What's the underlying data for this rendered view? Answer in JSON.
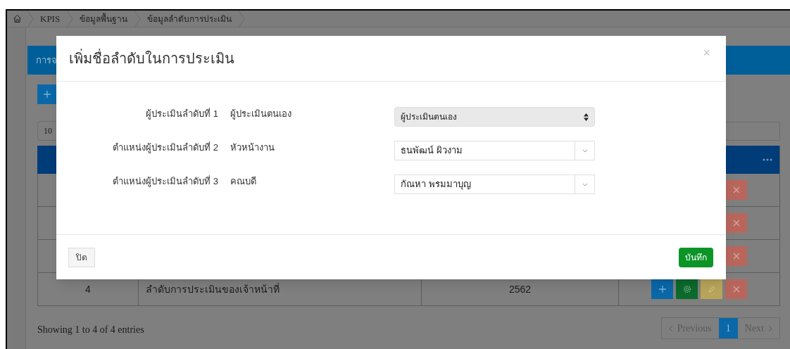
{
  "breadcrumb": [
    "KPIS",
    "ข้อมูลพื้นฐาน",
    "ข้อมูลลำดับการประเมิน"
  ],
  "panel": {
    "title": "การจ"
  },
  "page_length": "10",
  "table": {
    "rows": [
      {
        "cells": [],
        "actions": [
          {
            "kind": "delete"
          }
        ]
      },
      {
        "cells": [],
        "actions": [
          {
            "kind": "delete"
          }
        ]
      },
      {
        "cells": [],
        "actions": [
          {
            "kind": "delete"
          }
        ]
      },
      {
        "cells": [
          "4",
          "ลำดับการประเมินของเจ้าหน้าที่",
          "2562"
        ],
        "actions": [
          {
            "kind": "add"
          },
          {
            "kind": "settings"
          },
          {
            "kind": "edit"
          },
          {
            "kind": "delete"
          }
        ]
      }
    ]
  },
  "info": "Showing 1 to 4 of 4 entries",
  "pagination": [
    {
      "label": "Previous",
      "kind": "prev",
      "selected": false
    },
    {
      "label": "1",
      "kind": "page",
      "selected": true
    },
    {
      "label": "Next",
      "kind": "next",
      "selected": false
    }
  ],
  "modal": {
    "title": "เพิ่มชื่อลำดับในการประเมิน",
    "close": "×",
    "fields": [
      {
        "label": "ผู้ประเมินลำดับที่ 1",
        "role": "ผู้ประเมินตนเอง",
        "value": "ผู้ประเมินตนเอง",
        "kind": "native"
      },
      {
        "label": "ตำแหน่งผู้ประเมินลำดับที่ 2",
        "role": "หัวหน้างาน",
        "value": "ธนพัฒน์ ผิวงาม",
        "kind": "combo"
      },
      {
        "label": "ตำแหน่งผู้ประเมินลำดับที่ 3",
        "role": "คณบดี",
        "value": "กัณหา พรมมาบุญ",
        "kind": "combo"
      }
    ],
    "buttons": [
      {
        "label": "ปิด",
        "kind": "default"
      },
      {
        "label": "บันทึก",
        "kind": "primary"
      }
    ]
  }
}
